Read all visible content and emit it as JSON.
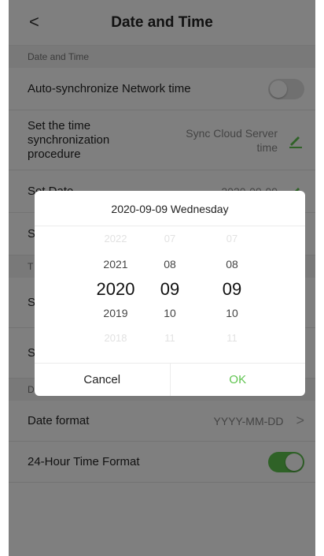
{
  "header": {
    "back_icon": "chevron-left-icon",
    "back_glyph": "<",
    "title": "Date and Time"
  },
  "section_date_time": "Date and Time",
  "auto_sync": {
    "label": "Auto-synchronize Network time",
    "toggle": "off"
  },
  "sync_procedure": {
    "label_lines": [
      "Set the time",
      "synchronization",
      "procedure"
    ],
    "value_lines": [
      "Sync Cloud Server",
      "time"
    ],
    "icon": "pencil-icon"
  },
  "set_date": {
    "label": "Set Date",
    "value": "2020-09-09",
    "icon": "pencil-icon"
  },
  "hidden_rows": {
    "row1_letter": "S",
    "section2_letter": "T",
    "row2_letter": "S",
    "row3_letter": "S",
    "section3_letter": "D"
  },
  "date_format": {
    "label": "Date format",
    "value": "YYYY-MM-DD",
    "chevron": ">"
  },
  "hour24": {
    "label": "24-Hour Time Format",
    "toggle": "on"
  },
  "dialog": {
    "title": "2020-09-09 Wednesday",
    "year_items": [
      "2022",
      "2021",
      "2020",
      "2019",
      "2018"
    ],
    "month_items": [
      "07",
      "08",
      "09",
      "10",
      "11"
    ],
    "day_items": [
      "07",
      "08",
      "09",
      "10",
      "11"
    ],
    "selected": {
      "year": "2020",
      "month": "09",
      "day": "09"
    },
    "cancel_label": "Cancel",
    "ok_label": "OK"
  },
  "colors": {
    "accent": "#5fc44f",
    "overlay": "rgba(0,0,0,0.5)",
    "section_bg": "#f2f2f2"
  }
}
